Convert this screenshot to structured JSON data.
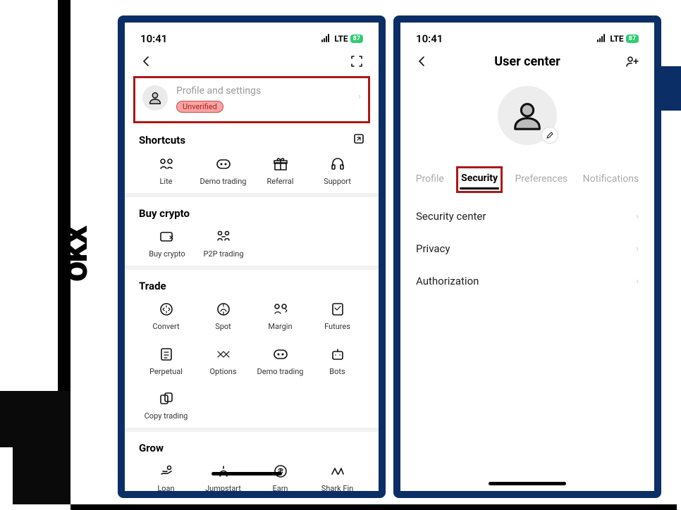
{
  "brand": "okx",
  "status": {
    "time": "10:41",
    "net": "LTE",
    "battery": "87"
  },
  "left": {
    "profile": {
      "title": "Profile and settings",
      "badge": "Unverified"
    },
    "sections": {
      "shortcuts": {
        "title": "Shortcuts",
        "items": [
          "Lite",
          "Demo trading",
          "Referral",
          "Support"
        ]
      },
      "buy": {
        "title": "Buy crypto",
        "items": [
          "Buy crypto",
          "P2P trading"
        ]
      },
      "trade": {
        "title": "Trade",
        "items": [
          "Convert",
          "Spot",
          "Margin",
          "Futures",
          "Perpetual",
          "Options",
          "Demo trading",
          "Bots",
          "Copy trading"
        ]
      },
      "grow": {
        "title": "Grow",
        "items": [
          "Loan",
          "Jumpstart",
          "Earn",
          "Shark Fin"
        ]
      }
    }
  },
  "right": {
    "title": "User center",
    "tabs": [
      "Profile",
      "Security",
      "Preferences",
      "Notifications"
    ],
    "active_tab": "Security",
    "menu": [
      "Security center",
      "Privacy",
      "Authorization"
    ]
  }
}
